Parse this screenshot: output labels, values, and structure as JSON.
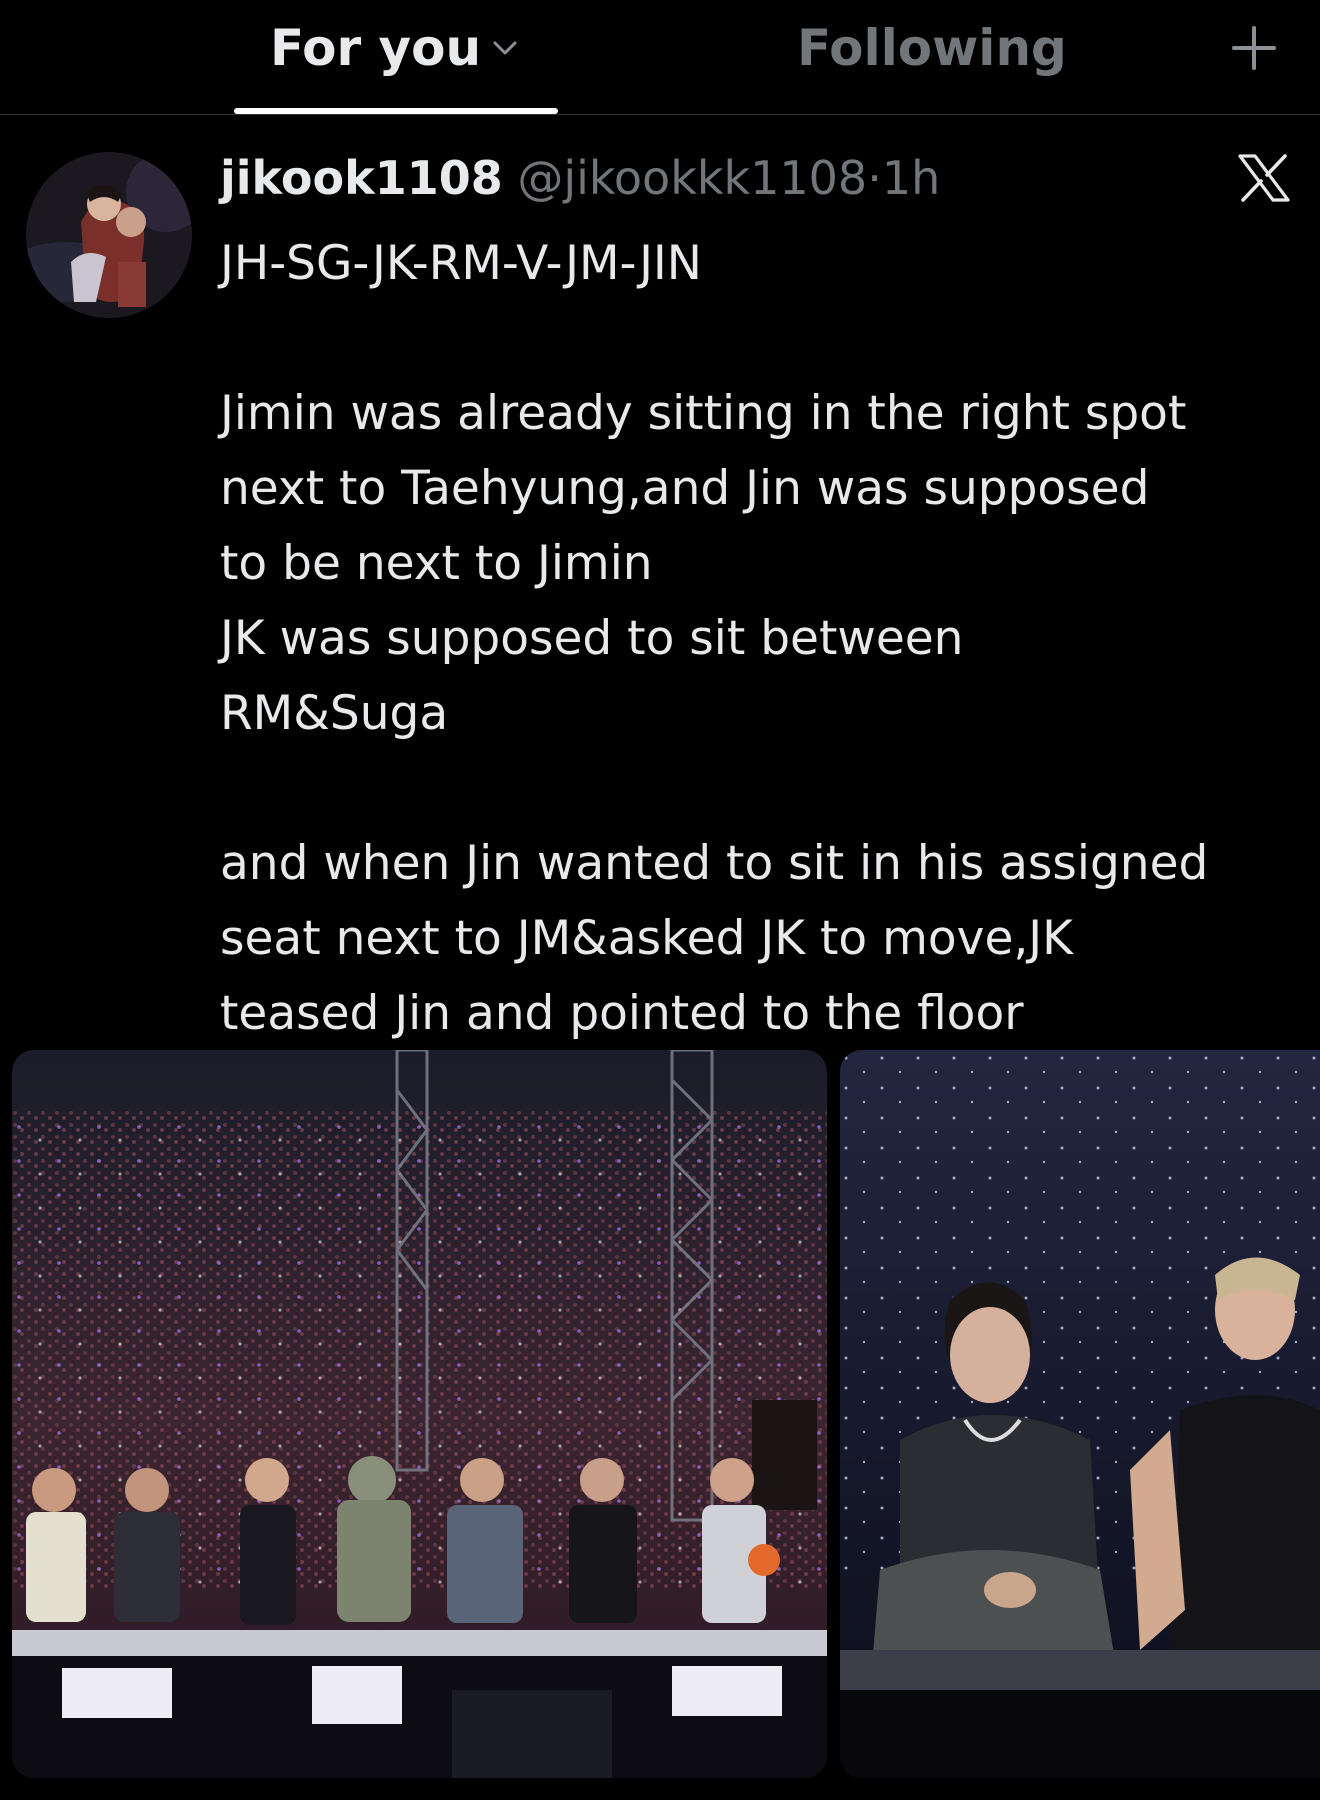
{
  "tabs": {
    "for_you": "For you",
    "following": "Following"
  },
  "colors": {
    "background": "#000000",
    "text_primary": "#e7e9ea",
    "text_secondary": "#71767b",
    "divider": "#2f3336"
  },
  "icons": {
    "tab_menu": "chevron-down-icon",
    "add_tab": "plus-icon",
    "brand": "x-logo-icon"
  },
  "tweet": {
    "display_name": "jikook1108",
    "handle": "@jikookkk1108",
    "separator": "·",
    "time": "1h",
    "paragraphs": [
      "JH-SG-JK-RM-V-JM-JIN",
      "Jimin was already sitting in the right spot\nnext to Taehyung,and Jin was supposed\nto be next to Jimin\nJK was supposed to sit between\nRM&Suga",
      "and when Jin wanted to sit in his assigned\nseat next to JM&asked JK to move,JK\nteased Jin and pointed to the floor"
    ]
  },
  "media": {
    "count": 2
  }
}
